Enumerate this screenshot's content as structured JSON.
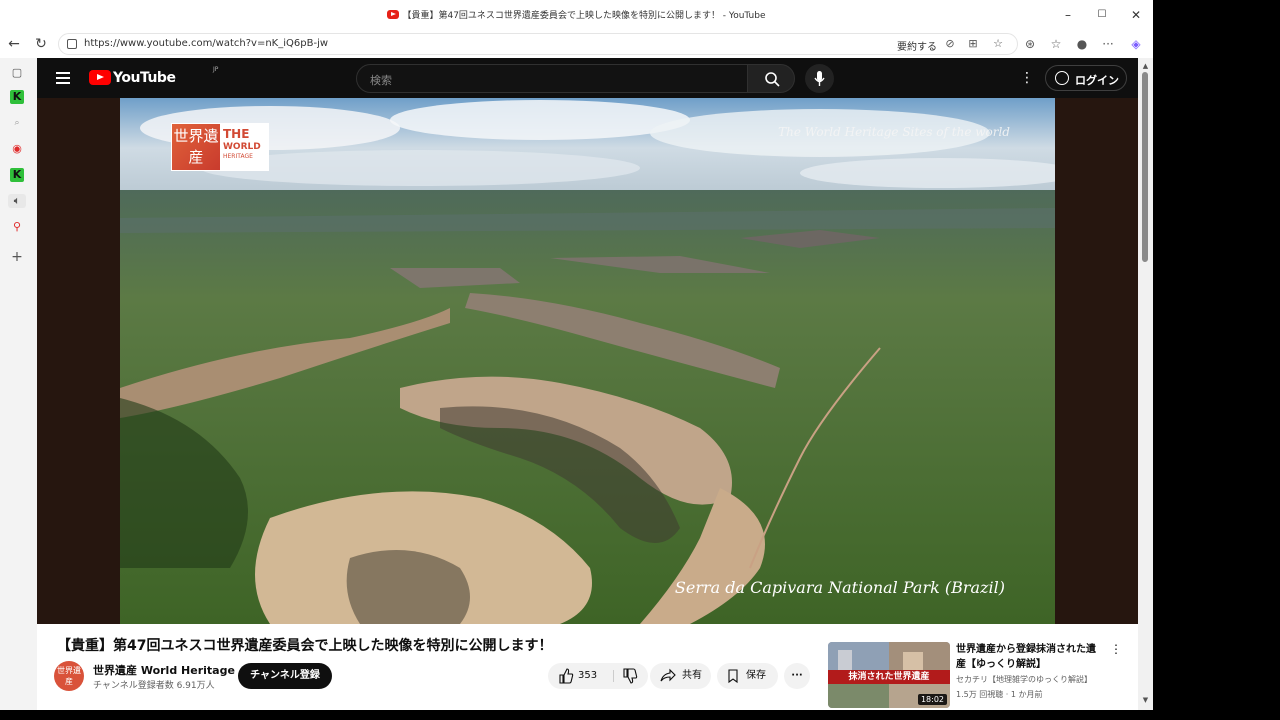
{
  "window": {
    "title": "【貴重】第47回ユネスコ世界遺産委員会で上映した映像を特別に公開します！ - YouTube",
    "minimize": "–",
    "maximize": "☐",
    "close": "✕"
  },
  "address_bar": {
    "url": "https://www.youtube.com/watch?v=nK_iQ6pB-jw",
    "summarize_label": "要約する"
  },
  "youtube": {
    "logo_text": "YouTube",
    "region": "JP",
    "search_placeholder": "検索",
    "login_label": "ログイン"
  },
  "video": {
    "logo_kanji": "世界遺産",
    "logo_the": "THE",
    "logo_world": "WORLD",
    "logo_heritage": "HERITAGE",
    "caption_top": "The World Heritage Sites of the world",
    "caption_bottom": "Serra da Capivara National Park (Brazil)"
  },
  "watch": {
    "title": "【貴重】第47回ユネスコ世界遺産委員会で上映した映像を特別に公開します！",
    "avatar_text": "世界遺産",
    "channel_name": "世界遺産 World Heritage",
    "subscribers": "チャンネル登録者数 6.91万人",
    "subscribe_label": "チャンネル登録",
    "like_count": "353",
    "share_label": "共有",
    "save_label": "保存",
    "more_label": "···"
  },
  "recommendation": {
    "thumb_text": "抹消された世界遺産",
    "duration": "18:02",
    "title": "世界遺産から登録抹消された遺産【ゆっくり解説】",
    "channel": "セカチリ【地理雑学のゆっくり解説】",
    "meta": "1.5万 回視聴 · 1 か月前"
  },
  "colors": {
    "yt_red": "#ff0000",
    "header_bg": "#0f0f0f",
    "brand_red": "#d24a34"
  }
}
